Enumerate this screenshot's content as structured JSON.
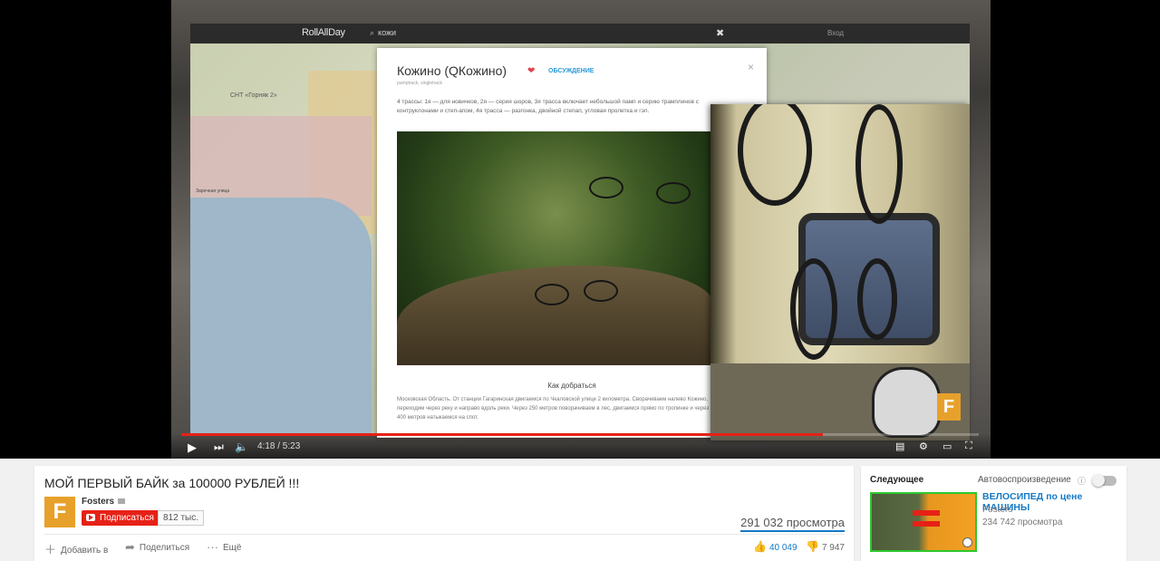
{
  "player": {
    "site": {
      "logo": "RollAllDay",
      "search": "кожи",
      "close": "✖",
      "login": "Вход"
    },
    "map": {
      "label1": "СНТ «Горняк 2»",
      "label2": "Заречная улица"
    },
    "modal": {
      "title": "Кожино (QКожино)",
      "discuss": "ОБСУЖДЕНИЕ",
      "close": "×",
      "tags": "pumptrack, singletrack",
      "description": "4 трассы: 1я — для новичков, 2я — серия шоров, 3я трасса включает небольшой памп и серию трамплинов с контруклонами и степ-апом, 4я трасса — разгонка, двойной степап, угловая пролетка и гэп.",
      "section": "Как добраться",
      "route": "Московская Область. От станции Гагаринская двигаемся по Чкаловской улице 2 километра. Сворачиваем налево Кожино, переходим через реку и направо вдоль реки. Через 250 метров поворачиваем в лес, двигаемся прямо по тропинке и через 400 метров натыкаемся на спот."
    },
    "overlay_logo": "F",
    "time": "4:18 / 5:23",
    "progress": 0.805,
    "accent": "#e62117"
  },
  "video": {
    "title": "МОЙ ПЕРВЫЙ БАЙК за 100000 РУБЛЕЙ !!!",
    "channel": "Fosters",
    "avatar_letter": "F",
    "subscribe_label": "Подписаться",
    "subscriber_count": "812 тыс.",
    "views": "291 032 просмотра",
    "actions": {
      "add": "Добавить в",
      "share": "Поделиться",
      "more": "Ещё"
    },
    "likes": "40 049",
    "dislikes": "7 947"
  },
  "sidebar": {
    "up_next": "Следующее",
    "autoplay": "Автовоспроизведение",
    "next": {
      "title": "ВЕЛОСИПЕД по цене МАШИНЫ",
      "channel": "Fosters",
      "views": "234 742 просмотра"
    }
  }
}
